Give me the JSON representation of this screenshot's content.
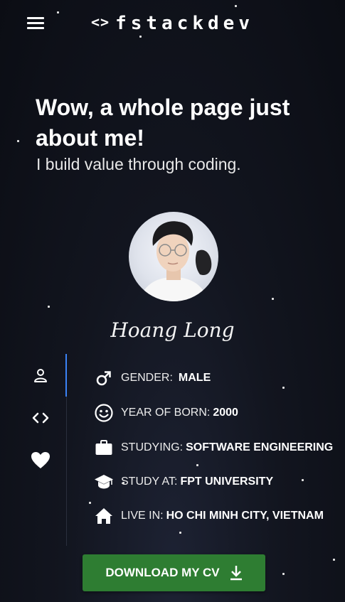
{
  "header": {
    "brand_icon": "<>",
    "brand_name": "fstackdev",
    "menu_icon": "hamburger-menu-icon"
  },
  "hero": {
    "title": "Wow, a whole page just about me!",
    "subtitle": "I build value through coding."
  },
  "profile": {
    "name": "Hoang Long",
    "avatar_icon": "profile-photo"
  },
  "sidenav": {
    "items": [
      {
        "icon": "person-icon",
        "active": true
      },
      {
        "icon": "code-icon",
        "active": false
      },
      {
        "icon": "heart-icon",
        "active": false
      }
    ],
    "accent": "#3b82f6"
  },
  "info": [
    {
      "icon": "male-icon",
      "label": "GENDER:",
      "value": "MALE"
    },
    {
      "icon": "smile-icon",
      "label": "YEAR OF BORN:",
      "value": "2000"
    },
    {
      "icon": "briefcase-icon",
      "label": "STUDYING:",
      "value": "SOFTWARE ENGINEERING"
    },
    {
      "icon": "graduation-cap-icon",
      "label": "STUDY AT:",
      "value": "FPT UNIVERSITY"
    },
    {
      "icon": "home-icon",
      "label": "LIVE IN:",
      "value": "HO CHI MINH CITY, VIETNAM"
    }
  ],
  "download_button": {
    "label": "DOWNLOAD MY CV",
    "icon": "download-icon",
    "color": "#2e7d32"
  },
  "colors": {
    "background": "#0b0d14",
    "text": "#ffffff"
  }
}
